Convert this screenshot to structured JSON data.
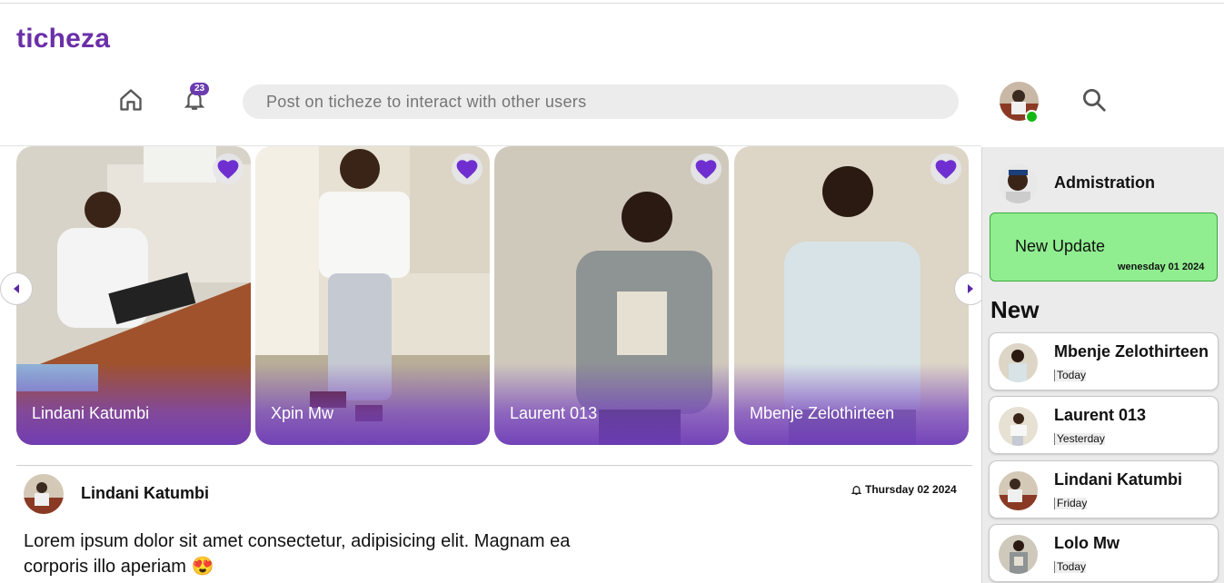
{
  "app": {
    "logo": "ticheza"
  },
  "header": {
    "notification_count": "23",
    "search_placeholder": "Post on ticheze to interact with other users",
    "icons": [
      "home-icon",
      "bell-icon",
      "search-icon"
    ]
  },
  "stories": [
    {
      "name": "Lindani Katumbi"
    },
    {
      "name": "Xpin Mw"
    },
    {
      "name": "Laurent 013"
    },
    {
      "name": "Mbenje Zelothirteen"
    }
  ],
  "post": {
    "author": "Lindani Katumbi",
    "date": "Thursday 02 2024",
    "body": "Lorem ipsum dolor sit amet consectetur, adipisicing elit. Magnam ea corporis illo aperiam 😍"
  },
  "sidebar": {
    "admin_title": "Admistration",
    "update_title": "New Update",
    "update_date": "wenesday 01 2024",
    "new_heading": "New",
    "users": [
      {
        "name": "Mbenje Zelothirteen",
        "time": "Today"
      },
      {
        "name": "Laurent 013",
        "time": "Yesterday"
      },
      {
        "name": "Lindani Katumbi",
        "time": "Friday"
      },
      {
        "name": "Lolo Mw",
        "time": "Today"
      }
    ]
  },
  "colors": {
    "brand": "#6b2fa8",
    "online": "#14b814",
    "update_bg": "#90ee90"
  }
}
